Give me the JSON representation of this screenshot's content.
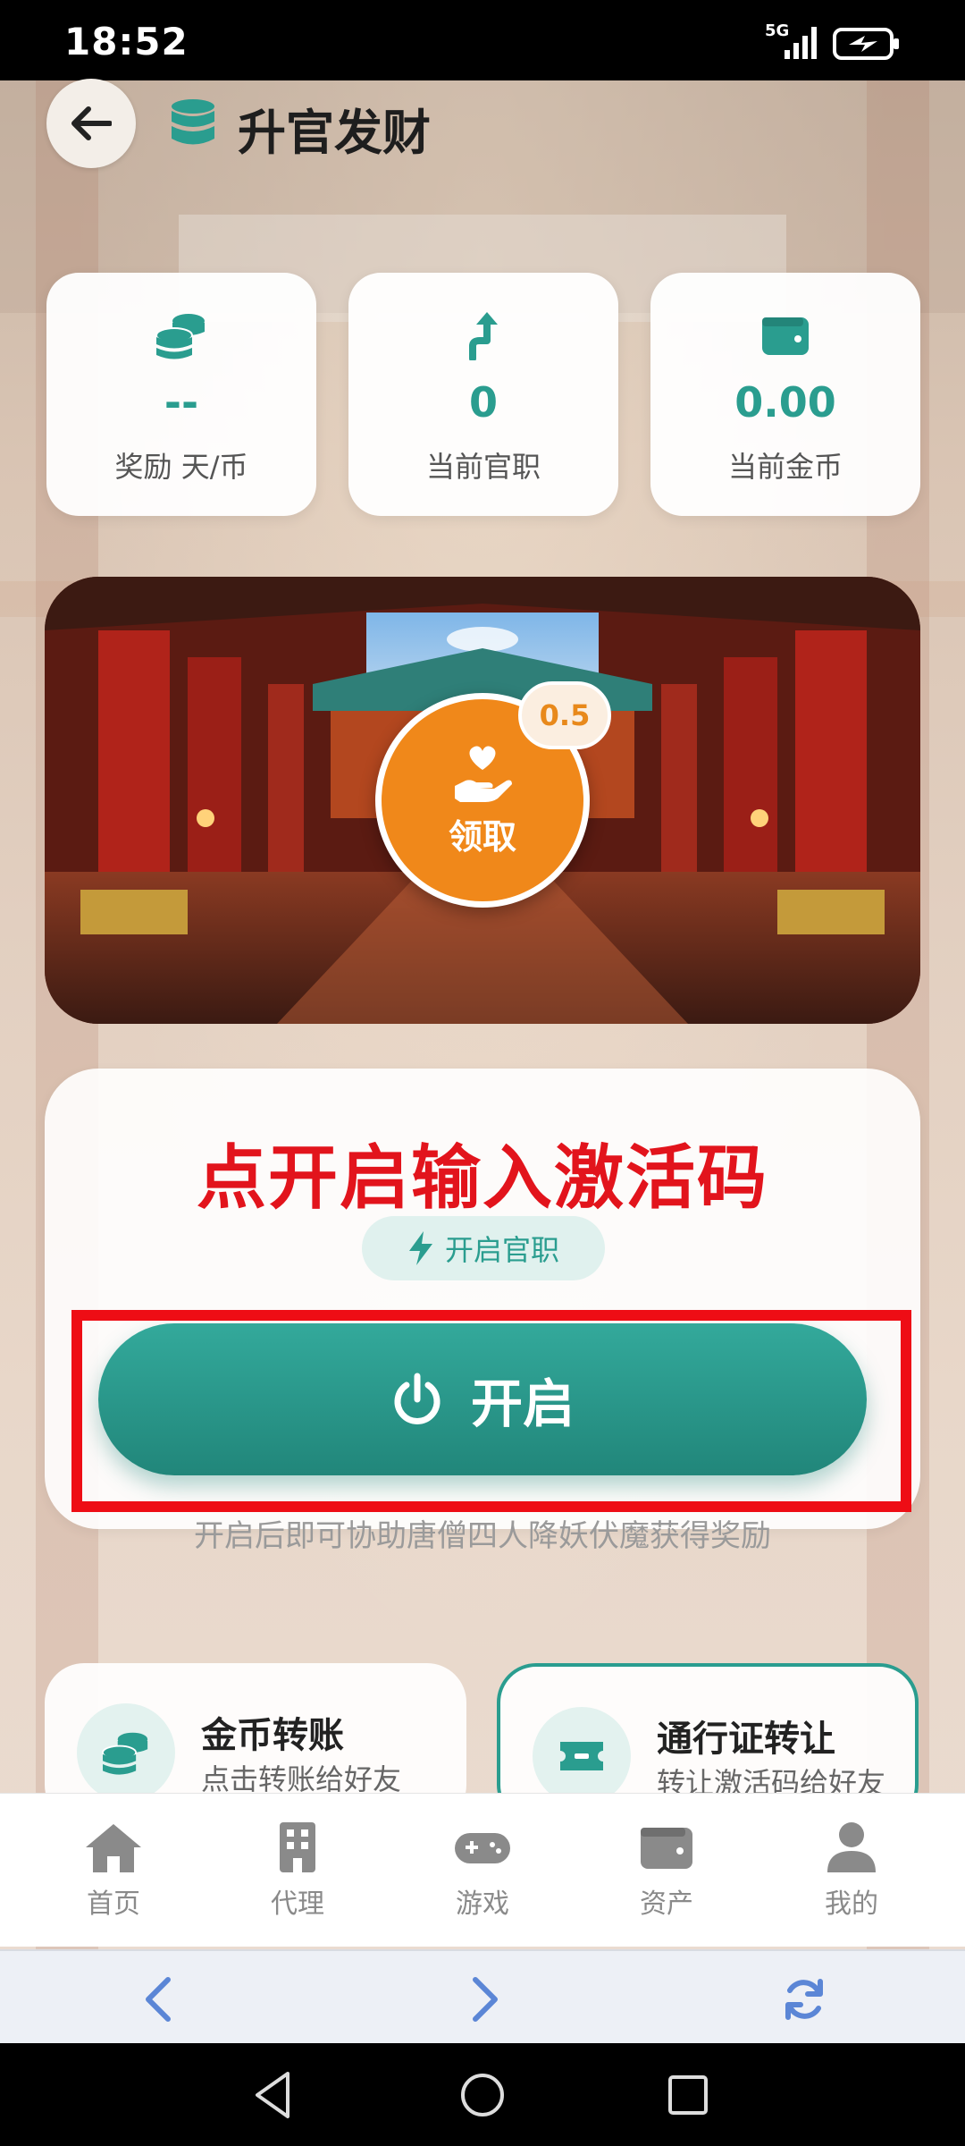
{
  "status_bar": {
    "time": "18:52",
    "network": "5G"
  },
  "header": {
    "title": "升官发财"
  },
  "stats": [
    {
      "value": "--",
      "label": "奖励 天/币",
      "icon": "coins-icon"
    },
    {
      "value": "0",
      "label": "当前官职",
      "icon": "arrow-up-icon"
    },
    {
      "value": "0.00",
      "label": "当前金币",
      "icon": "wallet-icon"
    }
  ],
  "banner": {
    "claim_label": "领取",
    "claim_badge": "0.5"
  },
  "action_card": {
    "annotation": "点开启输入激活码",
    "pill_label": "开启官职",
    "open_button_label": "开启",
    "help_text": "开启后即可协助唐僧四人降妖伏魔获得奖励"
  },
  "features": [
    {
      "title": "金币转账",
      "subtitle": "点击转账给好友",
      "icon": "coins-icon"
    },
    {
      "title": "通行证转让",
      "subtitle": "转让激活码给好友",
      "icon": "ticket-icon"
    }
  ],
  "bottom_nav": [
    {
      "label": "首页",
      "icon": "home-icon"
    },
    {
      "label": "代理",
      "icon": "building-icon"
    },
    {
      "label": "游戏",
      "icon": "gamepad-icon"
    },
    {
      "label": "资产",
      "icon": "wallet-icon"
    },
    {
      "label": "我的",
      "icon": "user-icon"
    }
  ],
  "colors": {
    "accent": "#2a9d8f",
    "orange": "#f0881a",
    "annotation_red": "#e2141c"
  }
}
